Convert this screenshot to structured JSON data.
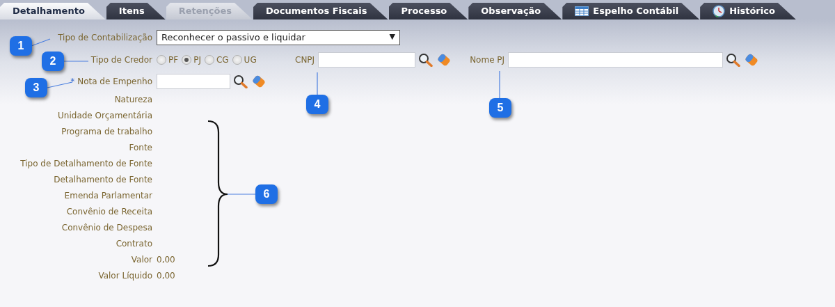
{
  "tabs": [
    {
      "label": "Detalhamento",
      "selected": true,
      "disabled": false,
      "kind": "plain"
    },
    {
      "label": "Itens",
      "selected": false,
      "disabled": false,
      "kind": "plain"
    },
    {
      "label": "Retenções",
      "selected": false,
      "disabled": true,
      "kind": "plain"
    },
    {
      "label": "Documentos Fiscais",
      "selected": false,
      "disabled": false,
      "kind": "plain"
    },
    {
      "label": "Processo",
      "selected": false,
      "disabled": false,
      "kind": "plain"
    },
    {
      "label": "Observação",
      "selected": false,
      "disabled": false,
      "kind": "plain"
    },
    {
      "label": "Espelho Contábil",
      "selected": false,
      "disabled": false,
      "kind": "table"
    },
    {
      "label": "Histórico",
      "selected": false,
      "disabled": false,
      "kind": "clock"
    }
  ],
  "contabilizacao": {
    "label": "Tipo de Contabilização",
    "value": "Reconhecer o passivo e liquidar",
    "caret": "▼"
  },
  "credor": {
    "label": "Tipo de Credor",
    "options": [
      {
        "label": "PF",
        "selected": false
      },
      {
        "label": "PJ",
        "selected": true
      },
      {
        "label": "CG",
        "selected": false
      },
      {
        "label": "UG",
        "selected": false
      }
    ]
  },
  "cnpj": {
    "label": "CNPJ"
  },
  "nome_pj": {
    "label": "Nome PJ"
  },
  "nota_empenho": {
    "required_mark": "*",
    "label": "Nota de Empenho"
  },
  "info_rows": [
    {
      "label": "Natureza"
    },
    {
      "label": "Unidade Orçamentária"
    },
    {
      "label": "Programa de trabalho"
    },
    {
      "label": "Fonte"
    },
    {
      "label": "Tipo de Detalhamento de Fonte"
    },
    {
      "label": "Detalhamento de Fonte"
    },
    {
      "label": "Emenda Parlamentar"
    },
    {
      "label": "Convênio de Receita"
    },
    {
      "label": "Convênio de Despesa"
    },
    {
      "label": "Contrato"
    },
    {
      "label": "Valor",
      "value": "0,00"
    },
    {
      "label": "Valor Líquido",
      "value": "0,00"
    }
  ],
  "callouts": [
    {
      "number": "1"
    },
    {
      "number": "2"
    },
    {
      "number": "3"
    },
    {
      "number": "4"
    },
    {
      "number": "5"
    },
    {
      "number": "6"
    }
  ]
}
